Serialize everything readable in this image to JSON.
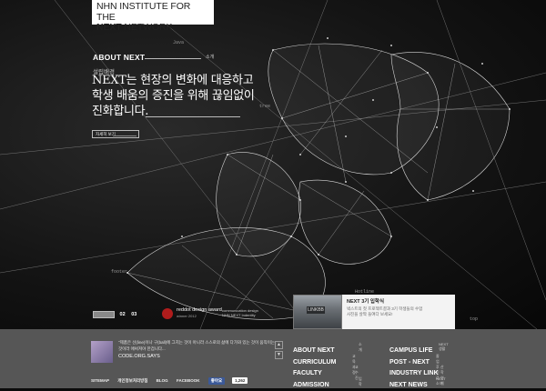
{
  "logo": {
    "line1": "NHN INSTITUTE FOR THE",
    "line2_bold": "NEXT",
    "line2_rest": " NETWORK"
  },
  "hero_tags": {
    "java": "Java",
    "tree": "tree",
    "foot": "footer",
    "hotline": "Hotline",
    "top": "top"
  },
  "about": {
    "title": "ABOUT NEXT",
    "title_sub": "소개",
    "category": "설립배경",
    "headline_1": "NEXT는 현장의 변화에 대응하고",
    "headline_2": "학생 배움의 증진을 위해 끊임없이",
    "headline_3": "진화합니다.",
    "more_label": "자세히 보기"
  },
  "pager": {
    "p2": "02",
    "p3": "03"
  },
  "award": {
    "t1": "reddot design award",
    "t2": "winner 2012",
    "t3a": "communication design",
    "t3b": "NHN NEXT Indentity"
  },
  "news": {
    "thumb_sign": "LINKBB",
    "title": "NEXT 3기 입학식 ",
    "desc_1": "넥스트의 첫 프로젝트결과 3기 학생들의 수업",
    "desc_2": "사진을 살짝 들여다 보세요!"
  },
  "twitter": {
    "text": "\"제품은 선(line)이나 구(ball)에 그치는 것이 아니라 스스로의 삶에 다가와 있는 것이 움직이는 것이라 애써져야 한겁니다...",
    "source": "CODE.ORG.SAYS",
    "up": "▲",
    "down": "▼"
  },
  "footer_links": {
    "sitemap": "SITEMAP",
    "privacy": "개인정보처리방침",
    "blog": "BLOG",
    "facebook": "FACEBOOK",
    "like": "좋아요",
    "count": "1,262"
  },
  "footer_nav": {
    "col1": [
      {
        "main": "ABOUT NEXT",
        "sub": "소개"
      },
      {
        "main": "CURRICULUM",
        "sub": "교육과정"
      },
      {
        "main": "FACULTY",
        "sub": "교수진"
      },
      {
        "main": "ADMISSION",
        "sub": "입학"
      }
    ],
    "col2": [
      {
        "main": "CAMPUS LIFE",
        "sub": "NEXT 생활"
      },
      {
        "main": "POST - NEXT",
        "sub": "졸업 후 진로"
      },
      {
        "main": "INDUSTRY LINK",
        "sub": "산학연계"
      },
      {
        "main": "NEXT NEWS",
        "sub": "NEXT 소식"
      }
    ]
  },
  "colors": {
    "footer_bg": "#565656",
    "hero_bg": "#141414",
    "accent_red": "#b01c1c",
    "facebook": "#3b5998"
  }
}
